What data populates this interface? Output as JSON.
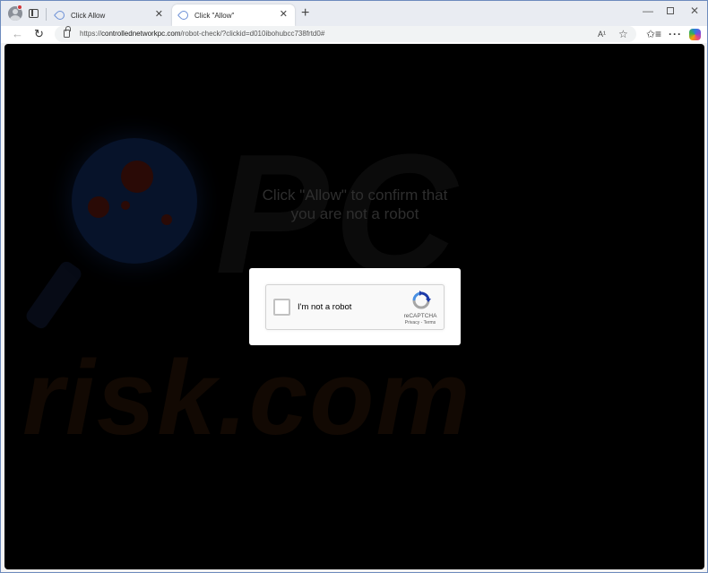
{
  "browser": {
    "tabs": [
      {
        "title": "Click Allow",
        "active": false,
        "close": "✕"
      },
      {
        "title": "Click \"Allow\"",
        "active": true,
        "close": "✕"
      }
    ],
    "new_tab": "+",
    "window_controls": {
      "minimize": "—",
      "maximize": "",
      "close": "✕"
    },
    "nav": {
      "back": "←",
      "reload": "↻"
    },
    "address": {
      "scheme": "https://",
      "host": "controllednetworkpc.com",
      "path": "/robot-check/?clickid=d010ibohubcc738frtd0#"
    },
    "toolbar_icons": {
      "read_aloud": "A¹",
      "favorite": "☆",
      "favorites_bar": "✩≡",
      "more": "···"
    }
  },
  "page": {
    "headline_line1": "Click \"Allow\" to confirm that",
    "headline_line2": "you are not a robot",
    "watermark": {
      "top": "PC",
      "bottom": "risk.com"
    },
    "captcha": {
      "label": "I'm not a robot",
      "brand": "reCAPTCHA",
      "privacy": "Privacy",
      "separator": " - ",
      "terms": "Terms",
      "checked": false
    }
  },
  "colors": {
    "page_background": "#000000",
    "headline": "#2e2e2e",
    "recaptcha_blue": "#1c3aa9",
    "recaptcha_gray": "#a6a6a6",
    "recaptcha_light_blue": "#4a90e2"
  }
}
